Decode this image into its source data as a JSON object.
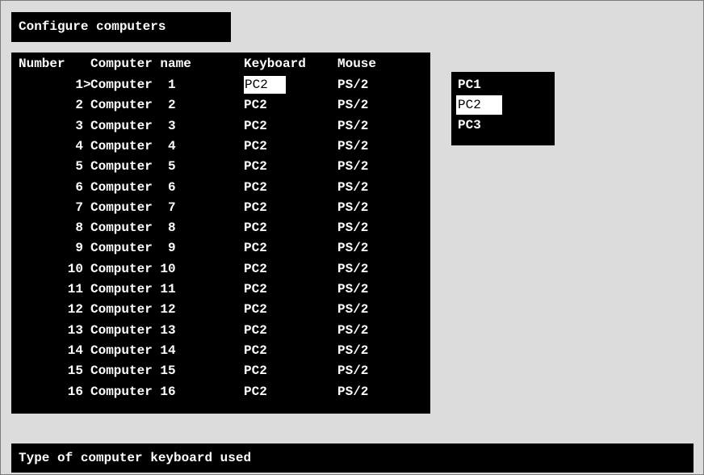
{
  "title": "Configure computers",
  "table": {
    "headers": {
      "number": "Number",
      "name": "Computer name",
      "keyboard": "Keyboard",
      "mouse": "Mouse"
    },
    "cursor_marker": ">",
    "rows": [
      {
        "number": "1",
        "name": "Computer  1",
        "keyboard": "PC2",
        "mouse": "PS/2"
      },
      {
        "number": "2",
        "name": "Computer  2",
        "keyboard": "PC2",
        "mouse": "PS/2"
      },
      {
        "number": "3",
        "name": "Computer  3",
        "keyboard": "PC2",
        "mouse": "PS/2"
      },
      {
        "number": "4",
        "name": "Computer  4",
        "keyboard": "PC2",
        "mouse": "PS/2"
      },
      {
        "number": "5",
        "name": "Computer  5",
        "keyboard": "PC2",
        "mouse": "PS/2"
      },
      {
        "number": "6",
        "name": "Computer  6",
        "keyboard": "PC2",
        "mouse": "PS/2"
      },
      {
        "number": "7",
        "name": "Computer  7",
        "keyboard": "PC2",
        "mouse": "PS/2"
      },
      {
        "number": "8",
        "name": "Computer  8",
        "keyboard": "PC2",
        "mouse": "PS/2"
      },
      {
        "number": "9",
        "name": "Computer  9",
        "keyboard": "PC2",
        "mouse": "PS/2"
      },
      {
        "number": "10",
        "name": "Computer 10",
        "keyboard": "PC2",
        "mouse": "PS/2"
      },
      {
        "number": "11",
        "name": "Computer 11",
        "keyboard": "PC2",
        "mouse": "PS/2"
      },
      {
        "number": "12",
        "name": "Computer 12",
        "keyboard": "PC2",
        "mouse": "PS/2"
      },
      {
        "number": "13",
        "name": "Computer 13",
        "keyboard": "PC2",
        "mouse": "PS/2"
      },
      {
        "number": "14",
        "name": "Computer 14",
        "keyboard": "PC2",
        "mouse": "PS/2"
      },
      {
        "number": "15",
        "name": "Computer 15",
        "keyboard": "PC2",
        "mouse": "PS/2"
      },
      {
        "number": "16",
        "name": "Computer 16",
        "keyboard": "PC2",
        "mouse": "PS/2"
      }
    ]
  },
  "keyboard_options": [
    "PC1",
    "PC2",
    "PC3"
  ],
  "status": "Type of computer keyboard used",
  "colors": {
    "background": "#dcdcdc",
    "panel": "#000000",
    "text": "#ffffff",
    "highlight": "#ffffff"
  }
}
